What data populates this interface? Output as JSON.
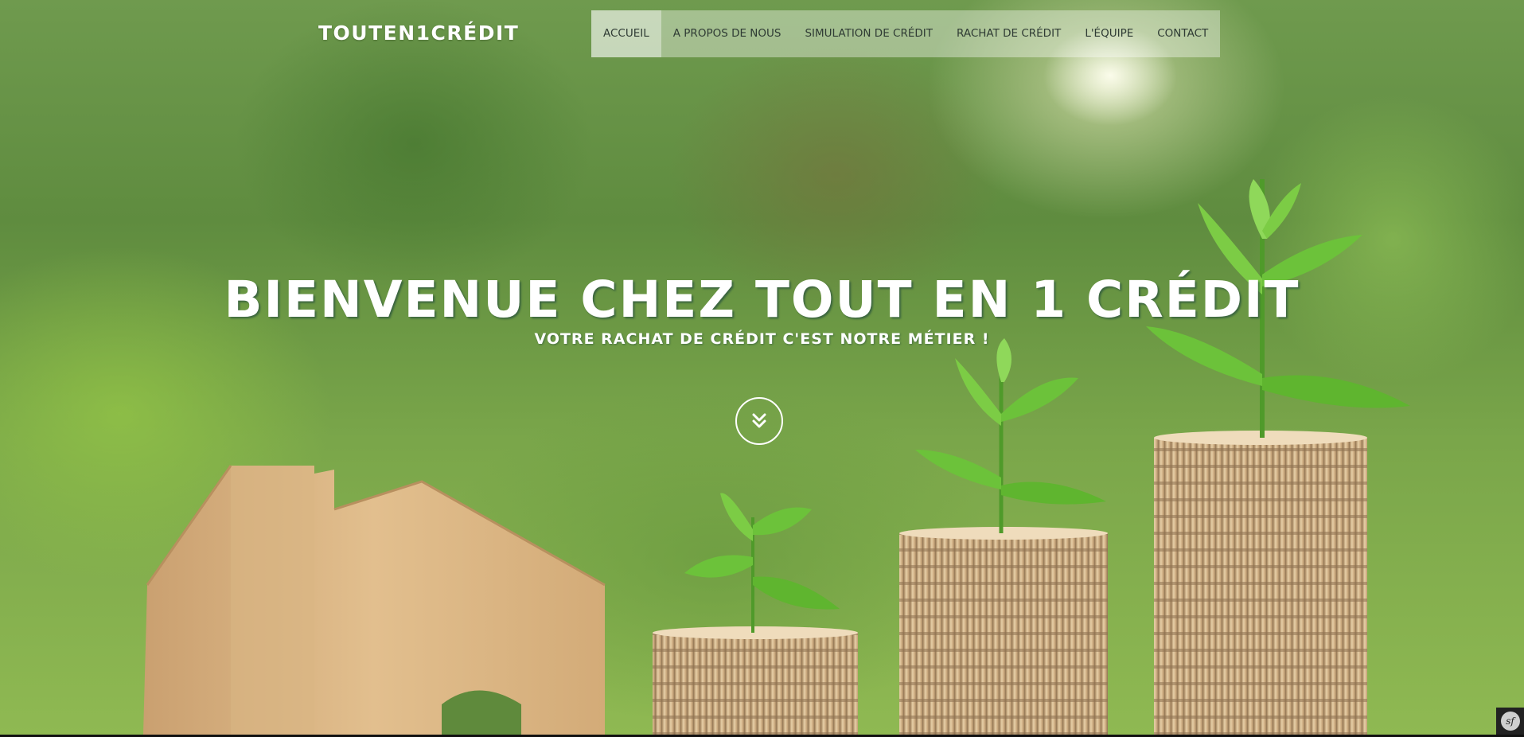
{
  "brand": {
    "name": "TOUTEN1CRÉDIT"
  },
  "nav": {
    "items": [
      {
        "label": "ACCUEIL",
        "active": true
      },
      {
        "label": "A PROPOS DE NOUS",
        "active": false
      },
      {
        "label": "SIMULATION DE CRÉDIT",
        "active": false
      },
      {
        "label": "RACHAT DE CRÉDIT",
        "active": false
      },
      {
        "label": "L'ÉQUIPE",
        "active": false
      },
      {
        "label": "CONTACT",
        "active": false
      }
    ]
  },
  "hero": {
    "title": "BIENVENUE CHEZ TOUT EN 1 CRÉDIT",
    "subtitle": "VOTRE RACHAT DE CRÉDIT C'EST NOTRE MÉTIER !",
    "scroll_icon": "double-chevron-down-icon"
  },
  "debug_toolbar": {
    "icon": "symfony-logo-icon",
    "logo_text": "sf"
  },
  "colors": {
    "nav_text": "#2f3b34",
    "hero_text": "#ffffff",
    "toolbar_bg": "#222222"
  }
}
